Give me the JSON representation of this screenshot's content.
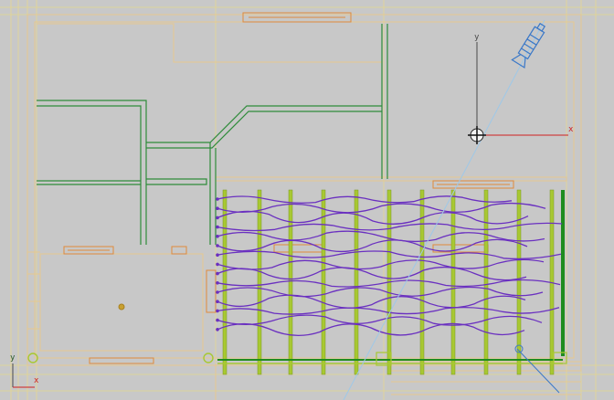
{
  "viewport": {
    "background": "#c8c8c8",
    "gizmo": {
      "x_label": "x",
      "y_label": "y"
    },
    "world_axis": {
      "x_label": "x",
      "y_label": "y"
    }
  },
  "colors": {
    "grid_major": "#e8d98a",
    "floor_outline": "#e6c98f",
    "walls": "#2e8b3a",
    "purple_splines": "#6a30c0",
    "posts": "#a8c832",
    "posts_dark": "#1e8c1e",
    "orange_objects": "#e08a3a",
    "camera": "#3a78c8",
    "axis_x": "#d02020",
    "axis_y": "#4a4a4a",
    "light_ray": "#9ec8e8"
  },
  "icons": [
    "camera-icon",
    "transform-gizmo-icon",
    "world-axis-icon"
  ]
}
